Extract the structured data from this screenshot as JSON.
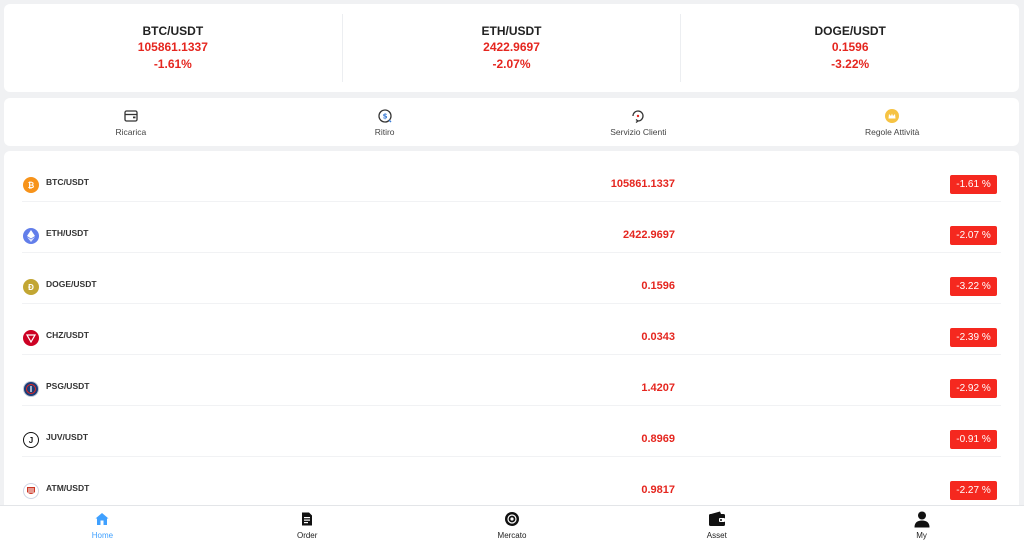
{
  "tickers": [
    {
      "pair": "BTC/USDT",
      "price": "105861.1337",
      "change": "-1.61%"
    },
    {
      "pair": "ETH/USDT",
      "price": "2422.9697",
      "change": "-2.07%"
    },
    {
      "pair": "DOGE/USDT",
      "price": "0.1596",
      "change": "-3.22%"
    }
  ],
  "menu": [
    {
      "label": "Ricarica",
      "icon": "wallet-card-icon"
    },
    {
      "label": "Ritiro",
      "icon": "withdraw-icon"
    },
    {
      "label": "Servizio Clienti",
      "icon": "customer-service-icon"
    },
    {
      "label": "Regole Attività",
      "icon": "crown-icon"
    }
  ],
  "market": [
    {
      "pair": "BTC/USDT",
      "price": "105861.1337",
      "change": "-1.61 %",
      "icon": "btc-icon",
      "color": "#f7931a"
    },
    {
      "pair": "ETH/USDT",
      "price": "2422.9697",
      "change": "-2.07 %",
      "icon": "eth-icon",
      "color": "#627eea"
    },
    {
      "pair": "DOGE/USDT",
      "price": "0.1596",
      "change": "-3.22 %",
      "icon": "doge-icon",
      "color": "#c2a633"
    },
    {
      "pair": "CHZ/USDT",
      "price": "0.0343",
      "change": "-2.39 %",
      "icon": "chz-icon",
      "color": "#cd0124"
    },
    {
      "pair": "PSG/USDT",
      "price": "1.4207",
      "change": "-2.92 %",
      "icon": "psg-icon",
      "color": "#1b3c78"
    },
    {
      "pair": "JUV/USDT",
      "price": "0.8969",
      "change": "-0.91 %",
      "icon": "juv-icon",
      "color": "#111111"
    },
    {
      "pair": "ATM/USDT",
      "price": "0.9817",
      "change": "-2.27 %",
      "icon": "atm-icon",
      "color": "#cb3524"
    }
  ],
  "tabs": [
    {
      "label": "Home",
      "icon": "home-icon",
      "active": true
    },
    {
      "label": "Order",
      "icon": "order-icon",
      "active": false
    },
    {
      "label": "Mercato",
      "icon": "market-icon",
      "active": false
    },
    {
      "label": "Asset",
      "icon": "wallet-icon",
      "active": false
    },
    {
      "label": "My",
      "icon": "user-icon",
      "active": false
    }
  ],
  "colors": {
    "accent": "#3fa0ff",
    "negative": "#e5261f",
    "badge": "#f5281f"
  }
}
